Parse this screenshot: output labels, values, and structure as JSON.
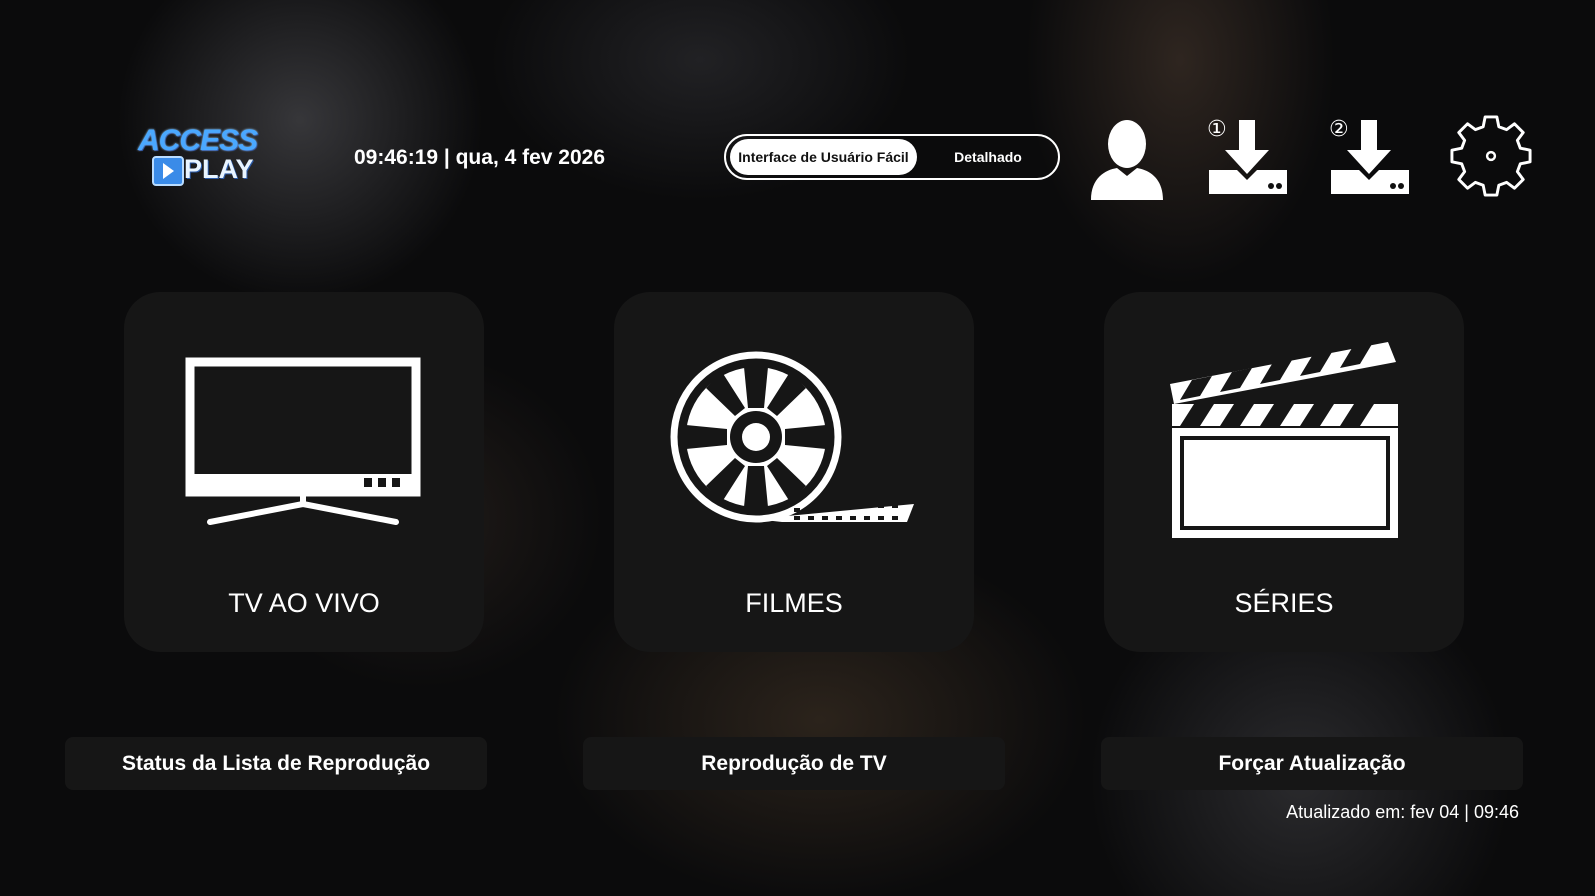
{
  "header": {
    "logo": {
      "top_text": "ACCESS",
      "bottom_text": "PLAY"
    },
    "datetime": "09:46:19 | qua, 4 fev 2026",
    "ui_mode": {
      "options": [
        "Interface de Usuário Fácil",
        "Detalhado"
      ],
      "selected": "Interface de Usuário Fácil"
    },
    "icons": {
      "user": "user-icon",
      "download_1": {
        "icon": "download-icon",
        "badge": "①"
      },
      "download_2": {
        "icon": "download-icon",
        "badge": "②"
      },
      "settings": "gear-icon"
    }
  },
  "cards": [
    {
      "label": "TV AO VIVO",
      "icon": "tv-icon"
    },
    {
      "label": "FILMES",
      "icon": "film-reel-icon"
    },
    {
      "label": "SÉRIES",
      "icon": "clapperboard-icon"
    }
  ],
  "actions": {
    "status": "Status da Lista de Reprodução",
    "tv_playback": "Reprodução de TV",
    "force_update": "Forçar Atualização"
  },
  "updated_text": "Atualizado em: fev 04 | 09:46",
  "colors": {
    "background": "#0b0b0c",
    "card": "#161616",
    "accent": "#ffffff",
    "logo_blue": "#4aa8ff"
  }
}
